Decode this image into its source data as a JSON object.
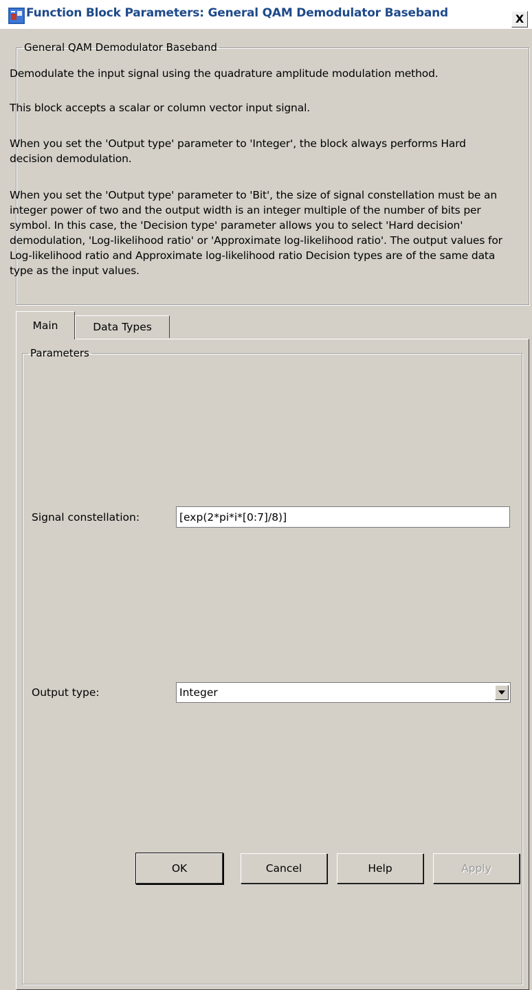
{
  "window": {
    "title": "Function Block Parameters: General QAM Demodulator Baseband",
    "close_label": "X"
  },
  "description": {
    "group_title": "General QAM Demodulator Baseband",
    "paragraphs": [
      "Demodulate the input signal using the quadrature amplitude modulation method.",
      "This block accepts a scalar or column vector input signal.",
      "When you set the 'Output type' parameter to 'Integer', the block always performs Hard decision demodulation.",
      "When you set the 'Output type' parameter to 'Bit', the size of signal constellation must be an integer power of two and the output width is an integer multiple of the number of bits per symbol. In this case, the 'Decision type' parameter allows you to select 'Hard decision' demodulation, 'Log-likelihood ratio' or 'Approximate log-likelihood ratio'. The output values for Log-likelihood ratio and Approximate log-likelihood ratio Decision types are of the same data type as the input values."
    ]
  },
  "tabs": [
    {
      "label": "Main",
      "active": true
    },
    {
      "label": "Data Types",
      "active": false
    }
  ],
  "parameters": {
    "group_title": "Parameters",
    "signal_constellation": {
      "label": "Signal constellation:",
      "value": "[exp(2*pi*i*[0:7]/8)]"
    },
    "output_type": {
      "label": "Output type:",
      "value": "Integer"
    }
  },
  "buttons": {
    "ok": "OK",
    "cancel": "Cancel",
    "help": "Help",
    "apply": "Apply"
  }
}
